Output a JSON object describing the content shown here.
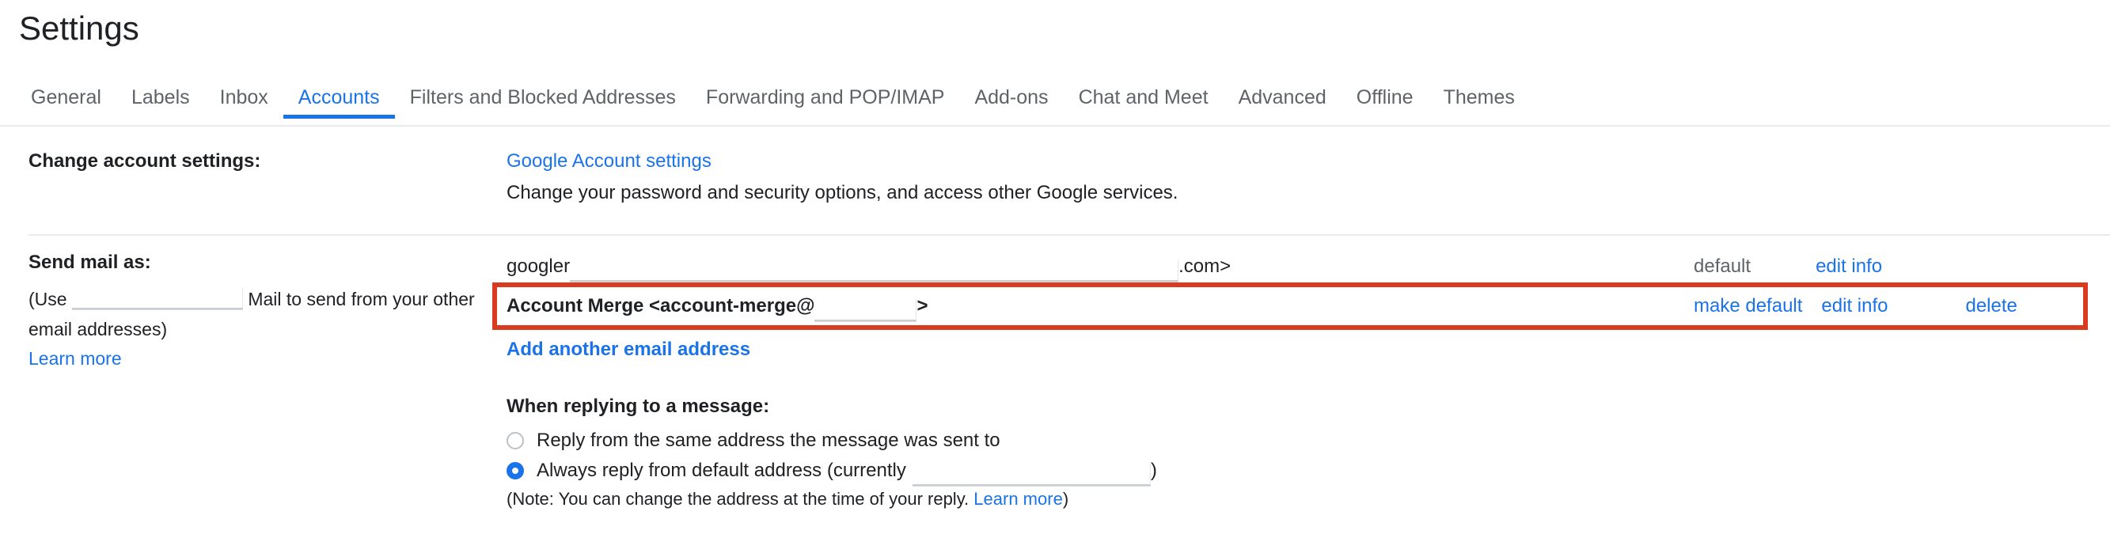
{
  "page": {
    "title": "Settings"
  },
  "tabs": [
    {
      "label": "General",
      "active": false
    },
    {
      "label": "Labels",
      "active": false
    },
    {
      "label": "Inbox",
      "active": false
    },
    {
      "label": "Accounts",
      "active": true
    },
    {
      "label": "Filters and Blocked Addresses",
      "active": false
    },
    {
      "label": "Forwarding and POP/IMAP",
      "active": false
    },
    {
      "label": "Add-ons",
      "active": false
    },
    {
      "label": "Chat and Meet",
      "active": false
    },
    {
      "label": "Advanced",
      "active": false
    },
    {
      "label": "Offline",
      "active": false
    },
    {
      "label": "Themes",
      "active": false
    }
  ],
  "change_account": {
    "label": "Change account settings:",
    "link_label": "Google Account settings",
    "description": "Change your password and security options, and access other Google services."
  },
  "send_mail_as": {
    "label": "Send mail as:",
    "sub_prefix": "(Use",
    "sub_suffix": "Mail to send from your other email addresses)",
    "learn_more": "Learn more",
    "add_another": "Add another email address",
    "rows": [
      {
        "address_prefix": "googler",
        "address_suffix": ".com>",
        "redacted": true,
        "bold": false,
        "status": "default",
        "actions": [
          "edit info"
        ],
        "highlighted": false
      },
      {
        "address_prefix": "Account Merge <account-merge@",
        "address_suffix": ">",
        "redacted": true,
        "bold": true,
        "status": "",
        "actions": [
          "make default",
          "edit info",
          "delete"
        ],
        "highlighted": true
      }
    ]
  },
  "when_replying": {
    "title": "When replying to a message:",
    "options": [
      {
        "label": "Reply from the same address the message was sent to",
        "selected": false,
        "has_redaction": false
      },
      {
        "label": "Always reply from default address (currently",
        "selected": true,
        "has_redaction": true,
        "suffix": ")"
      }
    ],
    "note_prefix": "(Note: You can change the address at the time of your reply.",
    "note_link": "Learn more",
    "note_suffix": ")"
  },
  "colors": {
    "accent": "#1a73e8",
    "highlight": "#d93b20",
    "muted": "#5f6368",
    "text": "#202124",
    "divider": "#e8eaed"
  }
}
